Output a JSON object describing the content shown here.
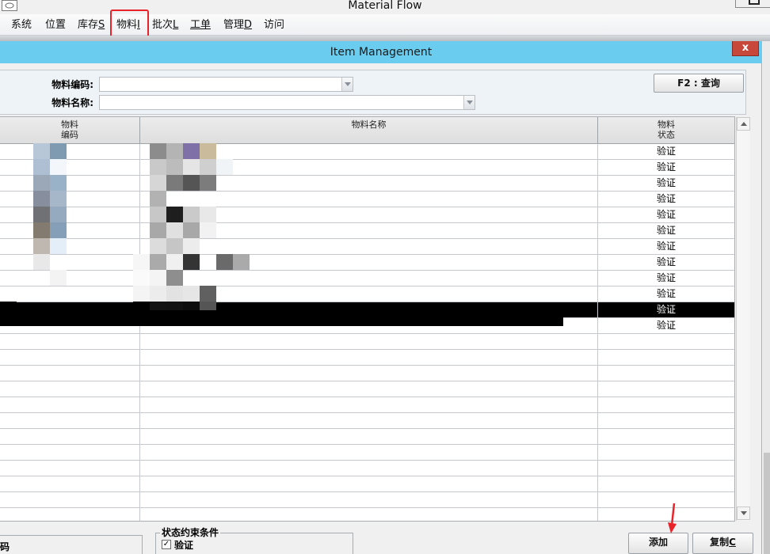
{
  "app": {
    "title": "Material Flow"
  },
  "menu": {
    "items": [
      {
        "id": "system",
        "text": "系统",
        "mnemonic": ""
      },
      {
        "id": "location",
        "text": "位置",
        "mnemonic": ""
      },
      {
        "id": "inventory",
        "text": "库存",
        "mnemonic": "S"
      },
      {
        "id": "material",
        "text": "物料",
        "mnemonic": "I"
      },
      {
        "id": "batch",
        "text": "批次",
        "mnemonic": "L"
      },
      {
        "id": "workorder",
        "text": "工单",
        "mnemonic": ""
      },
      {
        "id": "management",
        "text": "管理",
        "mnemonic": "D"
      },
      {
        "id": "access",
        "text": "访问",
        "mnemonic": ""
      }
    ]
  },
  "dialog": {
    "title": "Item Management",
    "close_label": "x"
  },
  "filter": {
    "code_label": "物料编码:",
    "code_value": "",
    "name_label": "物料名称:",
    "name_value": "",
    "query_button": "F2 : 查询"
  },
  "grid": {
    "columns": [
      "物料\n编码",
      "物料名称",
      "物料\n状态"
    ],
    "status_values": [
      "验证",
      "验证",
      "验证",
      "验证",
      "验证",
      "验证",
      "验证",
      "验证",
      "验证",
      "验证",
      "验证",
      "验证"
    ],
    "selected_row": 10,
    "empty_rows": 12
  },
  "bottom": {
    "left_partial_label": "码",
    "status_group_title": "状态约束条件",
    "status_checkbox_label": "验证",
    "status_checked": true,
    "add_button": "添加",
    "copy_button": "复制",
    "copy_mnemonic": "C"
  },
  "colors": {
    "dialog_title_bg": "#6acdf0",
    "close_bg": "#c7473b",
    "highlight": "#e8242a",
    "selected_row": "#000000"
  }
}
